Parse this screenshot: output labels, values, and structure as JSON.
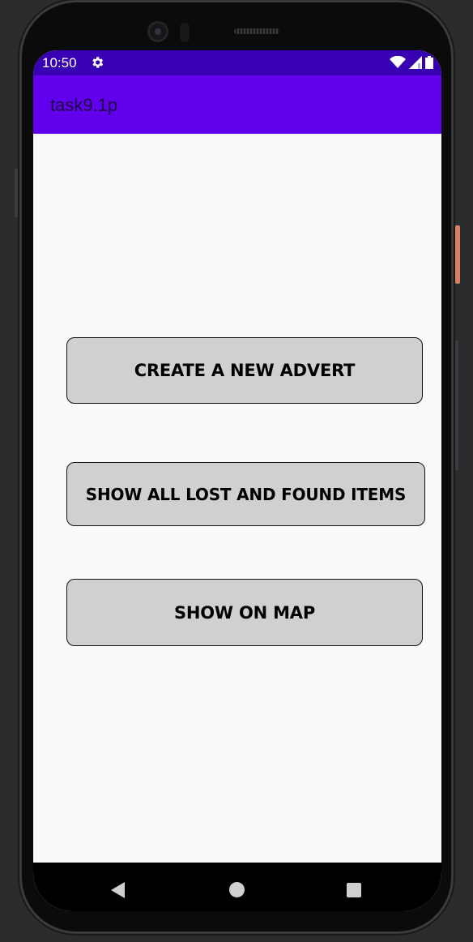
{
  "status_bar": {
    "time": "10:50",
    "icons": [
      "settings-gear-icon",
      "wifi-icon",
      "signal-icon",
      "battery-icon"
    ],
    "color": "#3700b3"
  },
  "app_bar": {
    "title": "task9.1p",
    "color": "#6200ee"
  },
  "buttons": {
    "create_advert": "CREATE A NEW ADVERT",
    "show_all": "SHOW ALL LOST AND FOUND ITEMS",
    "show_map": "SHOW ON MAP",
    "color": "#d0d0d0"
  },
  "nav_bar": {
    "icons": [
      "back-icon",
      "home-icon",
      "recents-icon"
    ]
  }
}
